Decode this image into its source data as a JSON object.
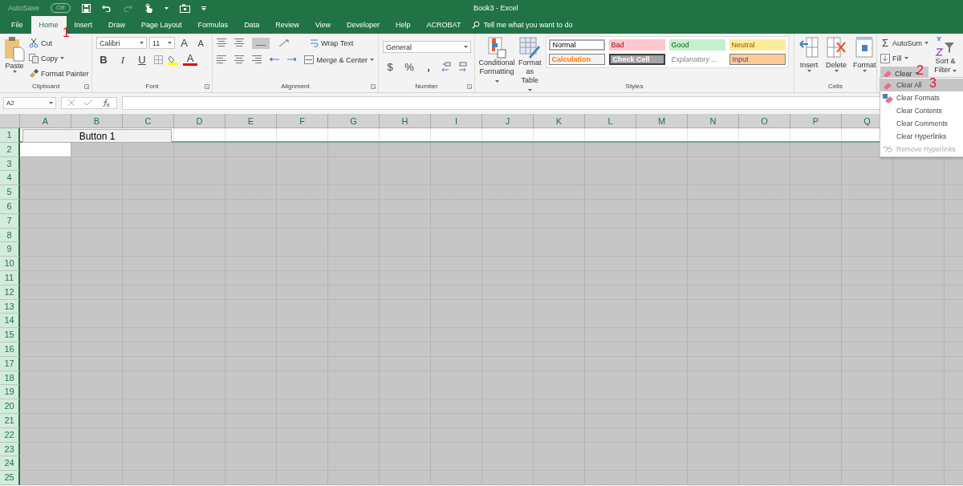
{
  "quick_access": {
    "autosave_label": "AutoSave",
    "autosave_state": "Off",
    "autosave_on": false,
    "redo_disabled": true
  },
  "window": {
    "title": "Book3  -  Excel"
  },
  "tabs": [
    {
      "label": "File",
      "selected": false
    },
    {
      "label": "Home",
      "selected": true
    },
    {
      "label": "Insert",
      "selected": false
    },
    {
      "label": "Draw",
      "selected": false
    },
    {
      "label": "Page Layout",
      "selected": false
    },
    {
      "label": "Formulas",
      "selected": false
    },
    {
      "label": "Data",
      "selected": false
    },
    {
      "label": "Review",
      "selected": false
    },
    {
      "label": "View",
      "selected": false
    },
    {
      "label": "Developer",
      "selected": false
    },
    {
      "label": "Help",
      "selected": false
    },
    {
      "label": "ACROBAT",
      "selected": false
    }
  ],
  "tell_me": {
    "placeholder": "Tell me what you want to do"
  },
  "clipboard": {
    "label": "Clipboard",
    "paste": "Paste",
    "cut": "Cut",
    "copy": "Copy",
    "format_painter": "Format Painter"
  },
  "font": {
    "label": "Font",
    "font_name": "Calibri",
    "font_size": "11",
    "grow": "A",
    "shrink": "A",
    "bold": "B",
    "italic": "I",
    "underline": "U",
    "font_color": "A"
  },
  "alignment": {
    "label": "Alignment",
    "wrap_text": "Wrap Text",
    "merge": "Merge & Center"
  },
  "number": {
    "label": "Number",
    "format": "General",
    "currency": "$",
    "percent": "%",
    "comma": ","
  },
  "styles": {
    "label": "Styles",
    "conditional_formatting": "Conditional Formatting",
    "format_as_table": "Format as Table",
    "cells": [
      {
        "label": "Normal",
        "kind": "normal"
      },
      {
        "label": "Bad",
        "kind": "bad"
      },
      {
        "label": "Good",
        "kind": "good"
      },
      {
        "label": "Neutral",
        "kind": "neutral"
      },
      {
        "label": "Calculation",
        "kind": "calculation"
      },
      {
        "label": "Check Cell",
        "kind": "check"
      },
      {
        "label": "Explanatory ...",
        "kind": "explanatory"
      },
      {
        "label": "Input",
        "kind": "input"
      }
    ]
  },
  "cells_group": {
    "label": "Cells",
    "buttons": [
      {
        "label": "Insert",
        "kind": "insert"
      },
      {
        "label": "Delete",
        "kind": "delete"
      },
      {
        "label": "Format",
        "kind": "format"
      }
    ]
  },
  "editing": {
    "autosum_icon": "Σ",
    "autosum": "AutoSum",
    "fill": "Fill",
    "clear": "Clear",
    "clear_expanded": true,
    "sort_filter": "Sort & Filter"
  },
  "clear_menu": [
    {
      "label": "Clear All",
      "selected": true,
      "disabled": false
    },
    {
      "label": "Clear Formats",
      "selected": false,
      "disabled": false
    },
    {
      "label": "Clear Contents",
      "selected": false,
      "disabled": false
    },
    {
      "label": "Clear Comments",
      "selected": false,
      "disabled": false
    },
    {
      "label": "Clear Hyperlinks",
      "selected": false,
      "disabled": false
    },
    {
      "label": "Remove Hyperlinks",
      "selected": false,
      "disabled": true
    }
  ],
  "name_box": {
    "value": "A2"
  },
  "sheet": {
    "columns": [
      "A",
      "B",
      "C",
      "D",
      "E",
      "F",
      "G",
      "H",
      "I",
      "J",
      "K",
      "L",
      "M",
      "N",
      "O",
      "P",
      "Q"
    ],
    "rows": [
      {
        "label": "1",
        "kind": "white"
      },
      {
        "label": "2",
        "kind": "cursor"
      },
      {
        "label": "3",
        "kind": "gray"
      },
      {
        "label": "4",
        "kind": "gray"
      },
      {
        "label": "5",
        "kind": "gray"
      },
      {
        "label": "6",
        "kind": "gray"
      },
      {
        "label": "7",
        "kind": "gray"
      },
      {
        "label": "8",
        "kind": "gray"
      },
      {
        "label": "9",
        "kind": "gray"
      },
      {
        "label": "10",
        "kind": "gray"
      },
      {
        "label": "11",
        "kind": "gray"
      },
      {
        "label": "12",
        "kind": "gray"
      },
      {
        "label": "13",
        "kind": "gray"
      },
      {
        "label": "14",
        "kind": "gray"
      },
      {
        "label": "15",
        "kind": "gray"
      },
      {
        "label": "16",
        "kind": "gray"
      },
      {
        "label": "17",
        "kind": "gray"
      },
      {
        "label": "18",
        "kind": "gray"
      },
      {
        "label": "19",
        "kind": "gray"
      },
      {
        "label": "20",
        "kind": "gray"
      },
      {
        "label": "21",
        "kind": "gray"
      },
      {
        "label": "22",
        "kind": "gray"
      },
      {
        "label": "23",
        "kind": "gray"
      },
      {
        "label": "24",
        "kind": "gray"
      },
      {
        "label": "25",
        "kind": "gray"
      }
    ],
    "button": "Button 1"
  },
  "annotations": [
    {
      "text": "1"
    },
    {
      "text": "2"
    },
    {
      "text": "3"
    }
  ]
}
